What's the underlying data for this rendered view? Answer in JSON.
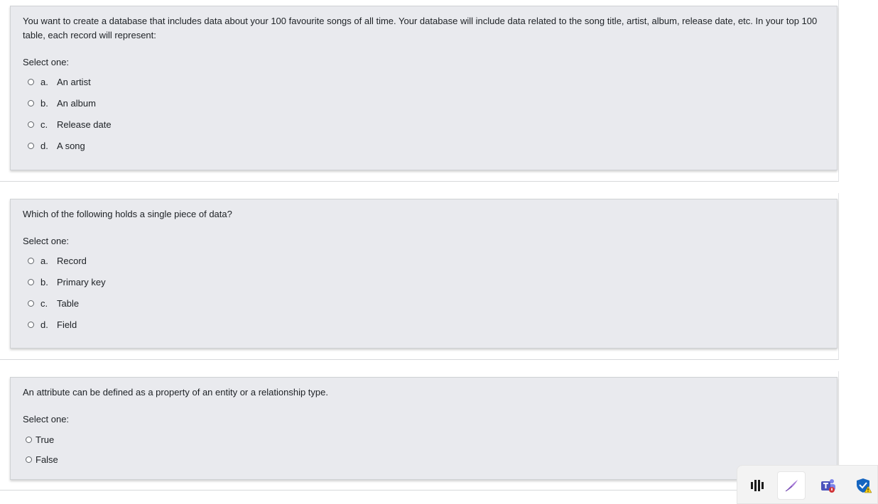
{
  "questions": [
    {
      "text": "You want to create a database that includes data about your 100 favourite songs of all time. Your database will include data related to the song title, artist, album, release date, etc. In your top 100 table, each record will represent:",
      "prompt": "Select one:",
      "options": [
        {
          "letter": "a.",
          "label": "An artist"
        },
        {
          "letter": "b.",
          "label": "An album"
        },
        {
          "letter": "c.",
          "label": "Release date"
        },
        {
          "letter": "d.",
          "label": "A song"
        }
      ]
    },
    {
      "text": "Which of the following holds a single piece of data?",
      "prompt": "Select one:",
      "options": [
        {
          "letter": "a.",
          "label": "Record"
        },
        {
          "letter": "b.",
          "label": "Primary key"
        },
        {
          "letter": "c.",
          "label": "Table"
        },
        {
          "letter": "d.",
          "label": "Field"
        }
      ]
    },
    {
      "text": "An attribute can be defined as a property of an entity or a relationship type.",
      "prompt": "Select one:",
      "options": [
        {
          "label": "True"
        },
        {
          "label": "False"
        }
      ]
    }
  ],
  "taskbar": {
    "icons": [
      "app-bars-icon",
      "feather-pen-icon",
      "teams-icon",
      "defender-shield-warning-icon"
    ]
  }
}
